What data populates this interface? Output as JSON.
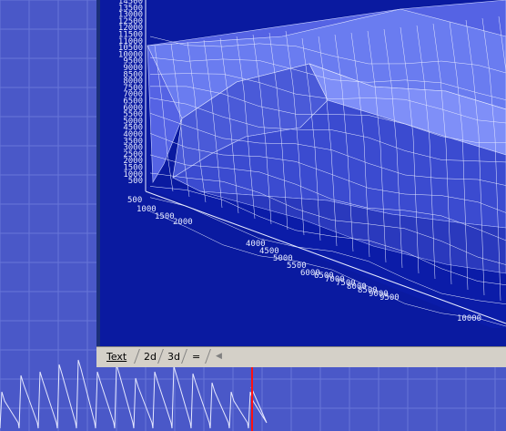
{
  "tabs": [
    {
      "label": "Text"
    },
    {
      "label": "2d"
    },
    {
      "label": "3d"
    },
    {
      "label": "="
    }
  ],
  "scroll_left_icon": "scroll-left-icon",
  "z_axis_ticks": [
    "14500",
    "13500",
    "13000",
    "12500",
    "12000",
    "11500",
    "11000",
    "10500",
    "10000",
    "9500",
    "9000",
    "8500",
    "8000",
    "7500",
    "7000",
    "6500",
    "6000",
    "5500",
    "5000",
    "4500",
    "4000",
    "3500",
    "3000",
    "2500",
    "2000",
    "1500",
    "1000",
    "500"
  ],
  "x_axis_ticks_a": [
    "500",
    "1000",
    "1500",
    "2000"
  ],
  "x_axis_ticks_b": [
    "4000",
    "4500",
    "5000",
    "5500",
    "6000",
    "6500",
    "7000",
    "7500",
    "8000",
    "8500",
    "9000",
    "9500",
    "10000"
  ],
  "x_axis_far": "10000",
  "colors": {
    "plot_bg": "#0a1aa0",
    "surface_light": "#6a7cf0",
    "surface_dark": "#3343c8",
    "grid_blue": "#5c6be0",
    "marker_red": "#ff1010",
    "desktop_bg": "#4a58c8"
  }
}
